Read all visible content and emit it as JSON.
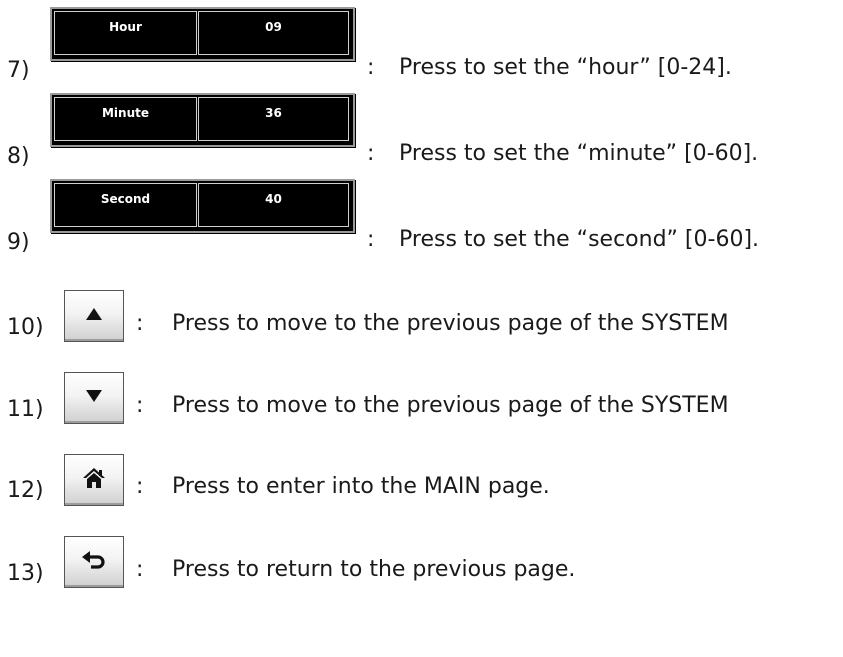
{
  "separator": ":",
  "rows": [
    {
      "num": "7)",
      "panel_label": "Hour",
      "panel_value": "09",
      "desc": "Press to set the “hour” [0-24]."
    },
    {
      "num": "8)",
      "panel_label": "Minute",
      "panel_value": "36",
      "desc": "Press to set the “minute” [0-60]."
    },
    {
      "num": "9)",
      "panel_label": "Second",
      "panel_value": "40",
      "desc": "Press to set the “second” [0-60]."
    },
    {
      "num": "10)",
      "icon": "up-arrow-icon",
      "desc": "Press to move to the previous page of the SYSTEM"
    },
    {
      "num": "11)",
      "icon": "down-arrow-icon",
      "desc": "Press to move to the previous page of the SYSTEM"
    },
    {
      "num": "12)",
      "icon": "home-icon",
      "desc": "Press to enter into the MAIN page."
    },
    {
      "num": "13)",
      "icon": "return-icon",
      "desc": "Press to return to the previous page."
    }
  ]
}
